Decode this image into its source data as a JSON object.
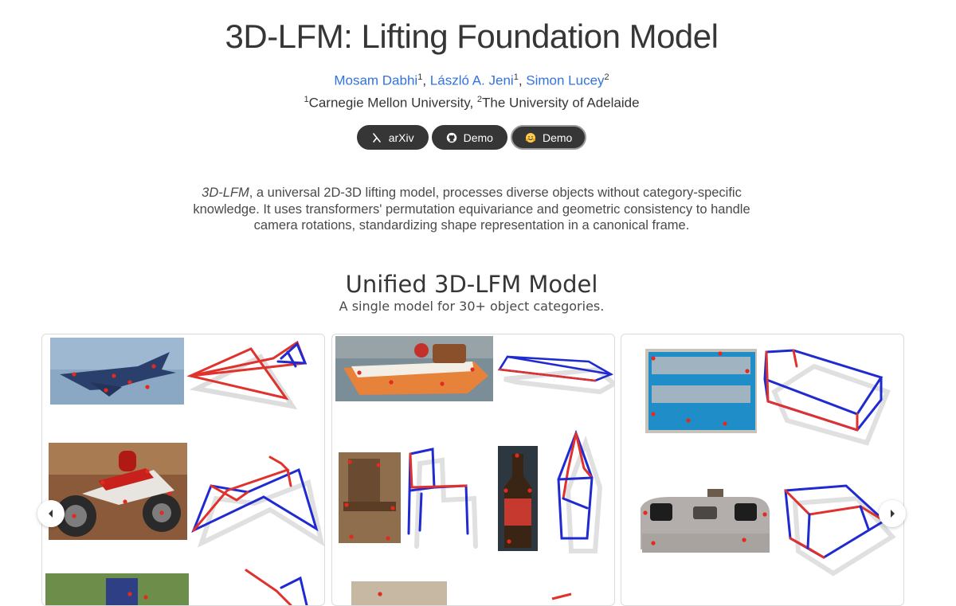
{
  "header": {
    "title": "3D-LFM: Lifting Foundation Model",
    "authors": [
      {
        "name": "Mosam Dabhi",
        "sup": "1"
      },
      {
        "name": "László A. Jeni",
        "sup": "1"
      },
      {
        "name": "Simon Lucey",
        "sup": "2"
      }
    ],
    "affiliations": [
      {
        "sup": "1",
        "name": "Carnegie Mellon University"
      },
      {
        "sup": "2",
        "name": "The University of Adelaide"
      }
    ],
    "links": [
      {
        "label": "arXiv",
        "icon": "arxiv-icon"
      },
      {
        "label": "Demo",
        "icon": "github-icon"
      },
      {
        "label": "Demo",
        "icon": "huggingface-icon"
      }
    ]
  },
  "abstract": {
    "name": "3D-LFM",
    "text": ", a universal 2D-3D lifting model, processes diverse objects without category-specific knowledge. It uses transformers' permutation equivariance and geometric consistency to handle camera rotations, standardizing shape representation in a canonical frame."
  },
  "section": {
    "title": "Unified 3D-LFM Model",
    "subtitle": "A single model for 30+ object categories."
  },
  "carousel": {
    "prev_icon": "chevron-left-icon",
    "next_icon": "chevron-right-icon",
    "colors": {
      "red": "#e0312c",
      "blue": "#1f2ad1",
      "keypoint": "#e32a1f"
    }
  }
}
